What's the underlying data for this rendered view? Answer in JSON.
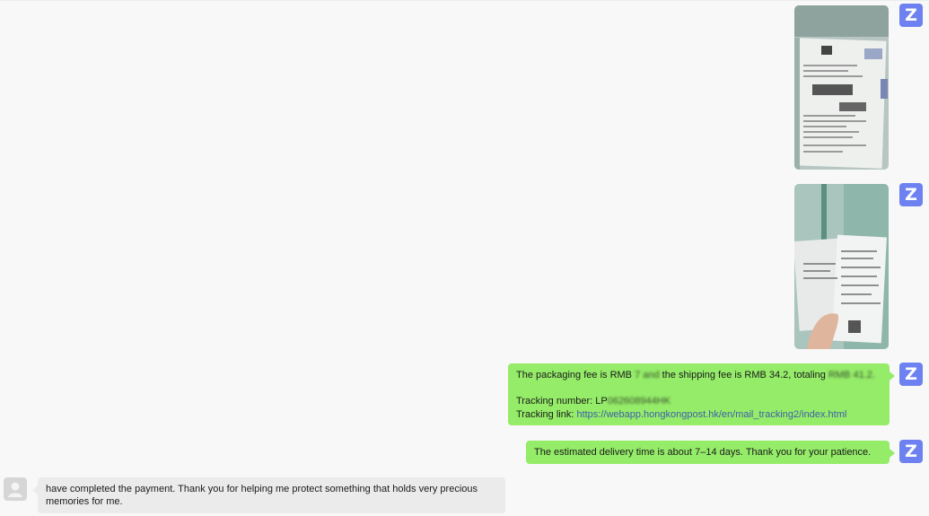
{
  "avatars": {
    "agent_letter": "Z"
  },
  "colors": {
    "agent_avatar": "#6d82f0",
    "outgoing_bubble": "#95ec69",
    "incoming_bubble": "#ebebeb",
    "link": "#3f5fa8"
  },
  "messages": {
    "fees": {
      "packaging_prefix": "The packaging fee is RMB ",
      "packaging_amount": "7 and",
      "shipping_prefix": " the shipping fee is RMB 34.2, totaling ",
      "total": "RMB 41.2.",
      "tracking_number_label": "Tracking number: LP",
      "tracking_number_value": "062608944HK",
      "tracking_link_label": "Tracking link: ",
      "tracking_link_url": "https://webapp.hongkongpost.hk/en/mail_tracking2/index.html"
    },
    "delivery": {
      "text": "The estimated delivery time is about 7–14 days. Thank you for your patience."
    },
    "customer_reply": {
      "line1": "have completed the payment. Thank you for helping me protect something that holds very precious",
      "line2": "memories for me."
    }
  }
}
